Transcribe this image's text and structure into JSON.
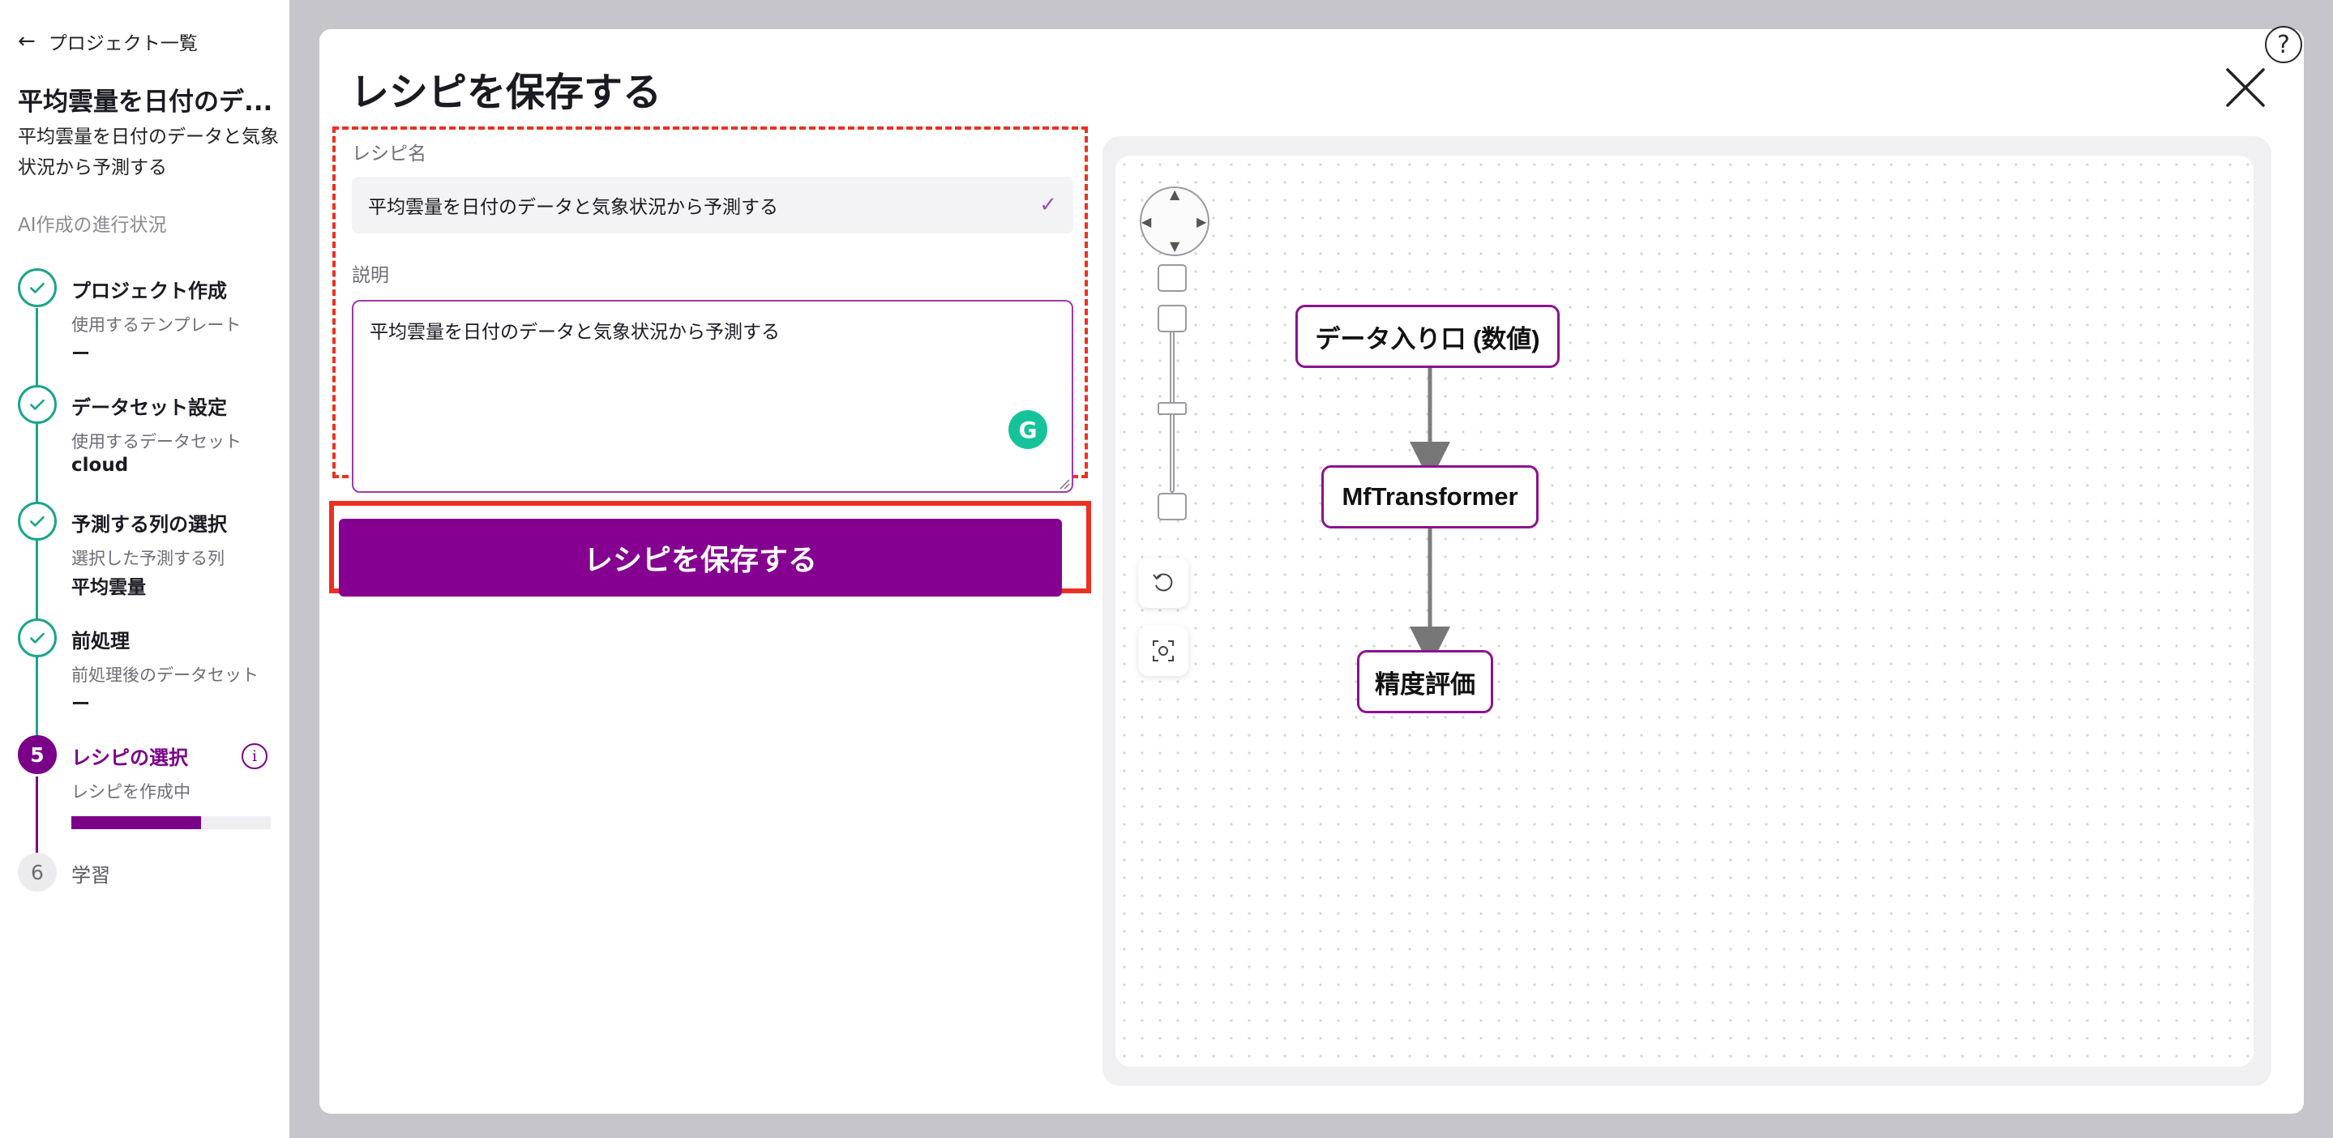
{
  "sidebar": {
    "back_label": "プロジェクト一覧",
    "project_title": "平均雲量を日付のデ...",
    "project_description": "平均雲量を日付のデータと気象状況から予測する",
    "progress_heading": "AI作成の進行状況",
    "steps": [
      {
        "title": "プロジェクト作成",
        "sub": "使用するテンプレート",
        "value": "ー",
        "state": "done"
      },
      {
        "title": "データセット設定",
        "sub": "使用するデータセット",
        "value": "cloud",
        "state": "done"
      },
      {
        "title": "予測する列の選択",
        "sub": "選択した予測する列",
        "value": "平均雲量",
        "state": "done"
      },
      {
        "title": "前処理",
        "sub": "前処理後のデータセット",
        "value": "ー",
        "state": "done"
      },
      {
        "number": "5",
        "title": "レシピの選択",
        "sub": "レシピを作成中",
        "state": "active",
        "progress": 0.65
      },
      {
        "number": "6",
        "title": "学習",
        "state": "pending"
      }
    ]
  },
  "modal": {
    "title": "レシピを保存する",
    "name_label": "レシピ名",
    "name_value": "平均雲量を日付のデータと気象状況から予測する",
    "description_label": "説明",
    "description_value": "平均雲量を日付のデータと気象状況から予測する",
    "save_button": "レシピを保存する"
  },
  "canvas": {
    "nodes": [
      "データ入り口 (数値)",
      "MfTransformer",
      "精度評価"
    ]
  },
  "colors": {
    "accent": "#850090",
    "check": "#1aa58a",
    "highlight": "#ec3121"
  },
  "icons": {
    "help": "question-mark-icon",
    "close": "close-icon",
    "grammarly": "grammarly-icon"
  }
}
